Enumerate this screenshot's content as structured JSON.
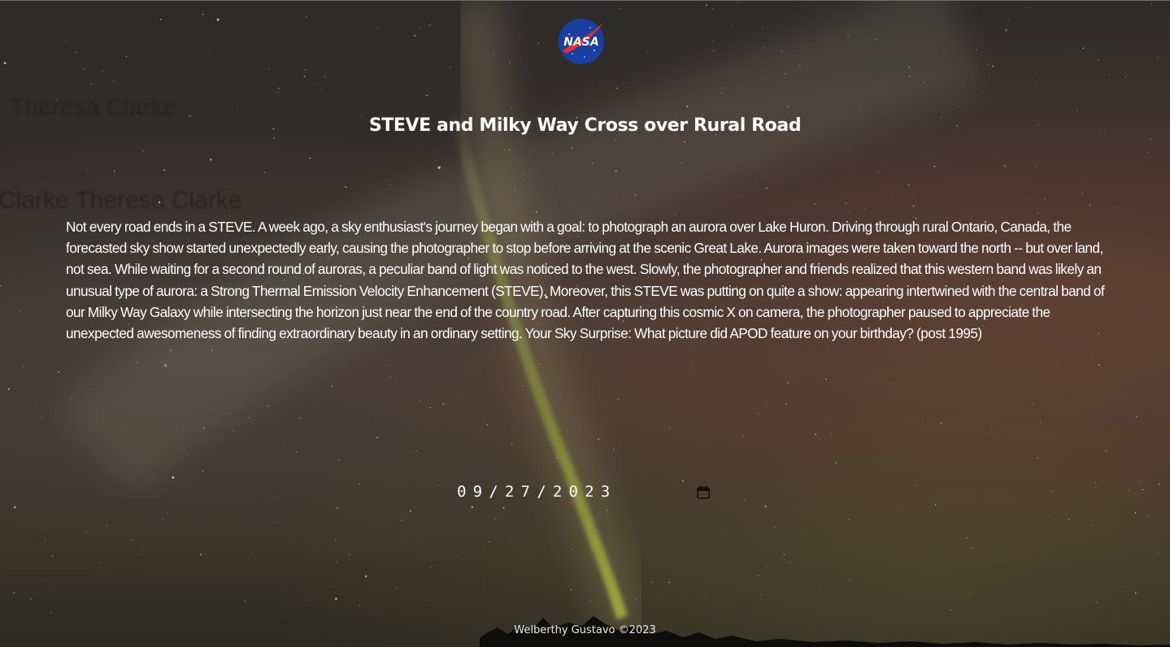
{
  "header": {
    "logo_icon": "nasa-logo-icon",
    "logo_text": "NASA"
  },
  "background_text": {
    "line1": "Theresa Clarke",
    "line2": "Clarke Theresa Clarke"
  },
  "apod": {
    "title": "STEVE and Milky Way Cross over Rural Road",
    "explanation": "Not every road ends in a STEVE. A week ago, a sky enthusiast's journey began with a goal: to photograph an aurora over Lake Huron. Driving through rural Ontario, Canada, the forecasted sky show started unexpectedly early, causing the photographer to stop before arriving at the scenic Great Lake. Aurora images were taken toward the north -- but over land, not sea. While waiting for a second round of auroras, a peculiar band of light was noticed to the west. Slowly, the photographer and friends realized that this western band was likely an unusual type of aurora: a Strong Thermal Emission Velocity Enhancement (STEVE). Moreover, this STEVE was putting on quite a show: appearing intertwined with the central band of our Milky Way Galaxy while intersecting the horizon just near the end of the country road. After capturing this cosmic X on camera, the photographer paused to appreciate the unexpected awesomeness of finding extraordinary beauty in an ordinary setting. Your Sky Surprise: What picture did APOD feature on your birthday? (post 1995)"
  },
  "date_picker": {
    "value": "09/27/2023",
    "icon": "calendar-icon"
  },
  "footer": {
    "text": "Welberthy Gustavo ©2023"
  },
  "colors": {
    "text": "#ffffff",
    "nasa_blue": "#1a3fa0",
    "nasa_red": "#e0322b",
    "aurora_green": "#9fb83a"
  }
}
